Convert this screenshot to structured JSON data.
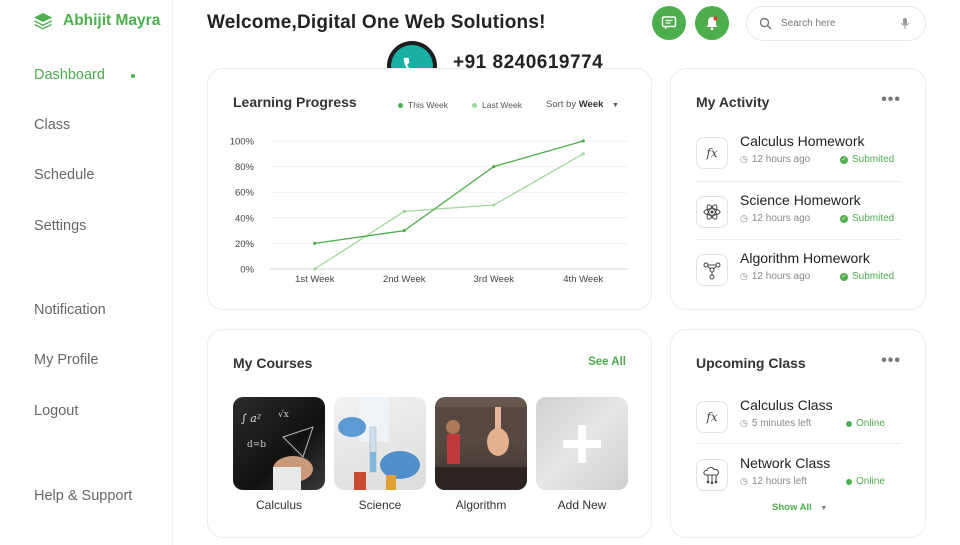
{
  "brand": {
    "name": "Abhijit Mayra"
  },
  "nav": {
    "dashboard": "Dashboard",
    "class": "Class",
    "schedule": "Schedule",
    "settings": "Settings",
    "notification": "Notification",
    "profile": "My Profile",
    "logout": "Logout",
    "help": "Help & Support"
  },
  "header": {
    "welcome": "Welcome,Digital One Web Solutions!",
    "phone": "+91 8240619774",
    "search_placeholder": "Search here"
  },
  "progress": {
    "title": "Learning Progress",
    "legend_this": "This Week",
    "legend_last": "Last Week",
    "sort_prefix": "Sort by",
    "sort_value": "Week"
  },
  "chart_data": {
    "type": "line",
    "categories": [
      "1st Week",
      "2nd Week",
      "3rd Week",
      "4th Week"
    ],
    "series": [
      {
        "name": "This Week",
        "values": [
          20,
          30,
          80,
          100
        ],
        "color": "#4cae4c"
      },
      {
        "name": "Last Week",
        "values": [
          0,
          45,
          50,
          90
        ],
        "color": "#9fd89a"
      }
    ],
    "yticks": [
      "0%",
      "20%",
      "40%",
      "60%",
      "80%",
      "100%"
    ],
    "ylim": [
      0,
      100
    ],
    "grid": true
  },
  "activity": {
    "title": "My Activity",
    "items": [
      {
        "title": "Calculus Homework",
        "time": "12 hours ago",
        "status": "Submited",
        "icon": "fx-icon"
      },
      {
        "title": "Science Homework",
        "time": "12 hours ago",
        "status": "Submited",
        "icon": "atom-icon"
      },
      {
        "title": "Algorithm Homework",
        "time": "12 hours ago",
        "status": "Submited",
        "icon": "network-icon"
      }
    ]
  },
  "courses": {
    "title": "My Courses",
    "see_all": "See All",
    "items": [
      {
        "label": "Calculus"
      },
      {
        "label": "Science"
      },
      {
        "label": "Algorithm"
      },
      {
        "label": "Add New"
      }
    ]
  },
  "upcoming": {
    "title": "Upcoming Class",
    "show_all": "Show All",
    "items": [
      {
        "title": "Calculus Class",
        "time": "5 minutes left",
        "status": "Online",
        "icon": "fx-icon"
      },
      {
        "title": "Network Class",
        "time": "12 hours left",
        "status": "Online",
        "icon": "cloud-network-icon"
      }
    ]
  },
  "colors": {
    "accent": "#4cae4c",
    "accent_light": "#9fd89a",
    "phone": "#17b0a3"
  }
}
